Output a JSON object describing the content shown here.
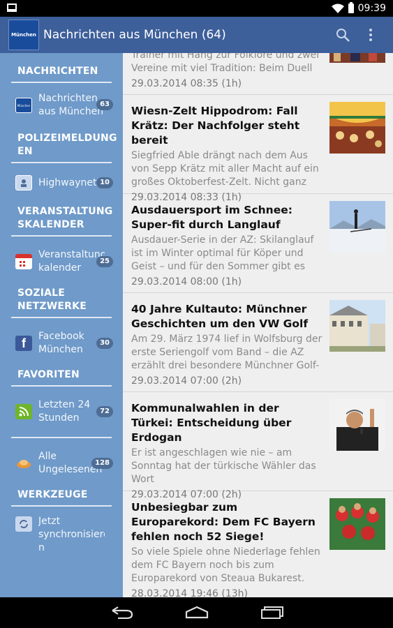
{
  "status": {
    "time": "09:39"
  },
  "header": {
    "logo_text": "München",
    "title": "Nachrichten aus München (64)"
  },
  "sidebar": {
    "sections": [
      {
        "title": "NACHRICHTEN"
      },
      {
        "title": "POLIZEIMELDUNG EN"
      },
      {
        "title": "VERANSTALTUNG SKALENDER"
      },
      {
        "title": "SOZIALE NETZWERKE"
      },
      {
        "title": "FAVORITEN"
      },
      {
        "title": "WERKZEUGE"
      }
    ],
    "items": [
      {
        "label": "Nachrichten aus München",
        "count": "63"
      },
      {
        "label": "Highwaynet",
        "count": "10"
      },
      {
        "label": "Veranstaltungs kalender",
        "count": "25"
      },
      {
        "label": "Facebook München",
        "count": "30"
      },
      {
        "label": "Letzten 24 Stunden",
        "count": "72"
      },
      {
        "label": "Alle Ungelesenen",
        "count": "128"
      },
      {
        "label": "Jetzt synchronisiere n",
        "count": ""
      }
    ]
  },
  "articles": [
    {
      "title": "",
      "snippet": "Trainer mit Hang zur Folklore und zwei Vereine mit viel Tradition: Beim Duell",
      "date": "29.03.2014 08:35 (1h)"
    },
    {
      "title": "Wiesn-Zelt Hippodrom: Fall Krätz: Der Nachfolger steht bereit",
      "snippet": "Siegfried Able drängt nach dem Aus von Sepp Krätz mit aller Macht auf ein großes Oktoberfest-Zelt. Nicht ganz",
      "date": "29.03.2014 08:33 (1h)"
    },
    {
      "title": "Ausdauersport im Schnee: Super-fit durch Langlauf",
      "snippet": "Ausdauer-Serie in der AZ: Skilanglauf ist im Winter optimal für Köper und Geist – und für den Sommer gibt es",
      "date": "29.03.2014 08:00 (1h)"
    },
    {
      "title": "40 Jahre Kultauto: Münchner Geschichten um den VW Golf",
      "snippet": "Am 29. März 1974 lief in Wolfsburg der erste Seriengolf vom Band – die AZ erzählt drei besondere Münchner Golf-",
      "date": "29.03.2014 07:00 (2h)"
    },
    {
      "title": "Kommunalwahlen in der Türkei: Entscheidung über Erdogan",
      "snippet": "Er ist angeschlagen wie nie – am Sonntag hat der türkische Wähler das Wort",
      "date": "29.03.2014 07:00 (2h)"
    },
    {
      "title": "Unbesiegbar zum Europarekord: Dem FC Bayern fehlen noch 52 Siege!",
      "snippet": "So viele Spiele ohne Niederlage fehlen dem FC Bayern noch bis zum Europarekord von Steaua Bukarest.",
      "date": "28.03.2014 19:46 (13h)"
    }
  ],
  "colors": {
    "actionbar": "#3d5f9a",
    "sidebar": "#6f9ac9",
    "badge": "#4e6d95",
    "content_bg": "#efefef"
  }
}
